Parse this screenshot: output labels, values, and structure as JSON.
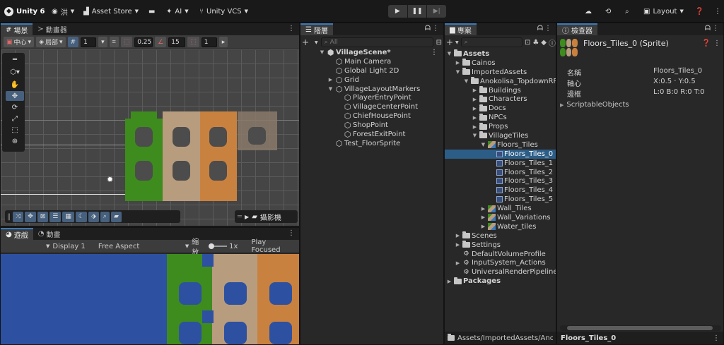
{
  "topbar": {
    "account": "Unity 6",
    "user": "洪",
    "asset_store": "Asset Store",
    "ai": "AI",
    "vcs": "Unity VCS",
    "layout": "Layout"
  },
  "scene": {
    "tabs": [
      "場景",
      "動畫器"
    ],
    "pivot": "中心",
    "space": "局部",
    "grid_size": "1",
    "snap_value": "0.25",
    "angle_value": "15",
    "scale_value": "1",
    "camera_label": "攝影機"
  },
  "game": {
    "tabs": [
      "遊戲",
      "動畫"
    ],
    "display": "Display 1",
    "aspect": "Free Aspect",
    "zoom_label": "縮放",
    "zoom_value": "1x",
    "play_mode": "Play Focused"
  },
  "hierarchy": {
    "tab": "階層",
    "search_placeholder": "All",
    "items": [
      {
        "label": "VillageScene*",
        "depth": 0,
        "arrow": "▼",
        "icon": "unity-icon",
        "bold": true
      },
      {
        "label": "Main Camera",
        "depth": 1,
        "arrow": "",
        "icon": "cube-icon"
      },
      {
        "label": "Global Light 2D",
        "depth": 1,
        "arrow": "",
        "icon": "cube-icon"
      },
      {
        "label": "Grid",
        "depth": 1,
        "arrow": "▶",
        "icon": "cube-icon"
      },
      {
        "label": "VillageLayoutMarkers",
        "depth": 1,
        "arrow": "▼",
        "icon": "cube-icon"
      },
      {
        "label": "PlayerEntryPoint",
        "depth": 2,
        "arrow": "",
        "icon": "cube-icon"
      },
      {
        "label": "VillageCenterPoint",
        "depth": 2,
        "arrow": "",
        "icon": "cube-icon"
      },
      {
        "label": "ChiefHousePoint",
        "depth": 2,
        "arrow": "",
        "icon": "cube-icon"
      },
      {
        "label": "ShopPoint",
        "depth": 2,
        "arrow": "",
        "icon": "cube-icon"
      },
      {
        "label": "ForestExitPoint",
        "depth": 2,
        "arrow": "",
        "icon": "cube-icon"
      },
      {
        "label": "Test_FloorSprite",
        "depth": 1,
        "arrow": "",
        "icon": "cube-icon"
      }
    ]
  },
  "project": {
    "tab": "專案",
    "path": "Assets/ImportedAssets/Anoko",
    "items": [
      {
        "label": "Assets",
        "depth": 0,
        "arrow": "▼",
        "icon": "folder-open",
        "bold": true
      },
      {
        "label": "Cainos",
        "depth": 1,
        "arrow": "▶",
        "icon": "folder"
      },
      {
        "label": "ImportedAssets",
        "depth": 1,
        "arrow": "▼",
        "icon": "folder-open"
      },
      {
        "label": "Anokolisa_TopdownRPG",
        "depth": 2,
        "arrow": "▼",
        "icon": "folder-open"
      },
      {
        "label": "Buildings",
        "depth": 3,
        "arrow": "▶",
        "icon": "folder"
      },
      {
        "label": "Characters",
        "depth": 3,
        "arrow": "▶",
        "icon": "folder"
      },
      {
        "label": "Docs",
        "depth": 3,
        "arrow": "▶",
        "icon": "folder"
      },
      {
        "label": "NPCs",
        "depth": 3,
        "arrow": "▶",
        "icon": "folder"
      },
      {
        "label": "Props",
        "depth": 3,
        "arrow": "▶",
        "icon": "folder"
      },
      {
        "label": "VillageTiles",
        "depth": 3,
        "arrow": "▼",
        "icon": "folder-open"
      },
      {
        "label": "Floors_Tiles",
        "depth": 4,
        "arrow": "▼",
        "icon": "sheet"
      },
      {
        "label": "Floors_Tiles_0",
        "depth": 5,
        "arrow": "",
        "icon": "sprite",
        "selected": true
      },
      {
        "label": "Floors_Tiles_1",
        "depth": 5,
        "arrow": "",
        "icon": "sprite"
      },
      {
        "label": "Floors_Tiles_2",
        "depth": 5,
        "arrow": "",
        "icon": "sprite"
      },
      {
        "label": "Floors_Tiles_3",
        "depth": 5,
        "arrow": "",
        "icon": "sprite"
      },
      {
        "label": "Floors_Tiles_4",
        "depth": 5,
        "arrow": "",
        "icon": "sprite"
      },
      {
        "label": "Floors_Tiles_5",
        "depth": 5,
        "arrow": "",
        "icon": "sprite"
      },
      {
        "label": "Wall_Tiles",
        "depth": 4,
        "arrow": "▶",
        "icon": "sheet"
      },
      {
        "label": "Wall_Variations",
        "depth": 4,
        "arrow": "▶",
        "icon": "sheet"
      },
      {
        "label": "Water_tiles",
        "depth": 4,
        "arrow": "▶",
        "icon": "sheet"
      },
      {
        "label": "Scenes",
        "depth": 1,
        "arrow": "▶",
        "icon": "folder"
      },
      {
        "label": "Settings",
        "depth": 1,
        "arrow": "▶",
        "icon": "folder"
      },
      {
        "label": "DefaultVolumeProfile",
        "depth": 1,
        "arrow": "",
        "icon": "asset"
      },
      {
        "label": "InputSystem_Actions",
        "depth": 1,
        "arrow": "▶",
        "icon": "asset"
      },
      {
        "label": "UniversalRenderPipelineGl",
        "depth": 1,
        "arrow": "",
        "icon": "asset"
      },
      {
        "label": "Packages",
        "depth": 0,
        "arrow": "▶",
        "icon": "folder",
        "bold": true
      }
    ]
  },
  "inspector": {
    "tab": "檢查器",
    "title": "Floors_Tiles_0 (Sprite)",
    "fields": [
      {
        "key": "名稱",
        "value": "Floors_Tiles_0"
      },
      {
        "key": "軸心",
        "value": "X:0.5 · Y:0.5"
      },
      {
        "key": "邊框",
        "value": "L:0 B:0 R:0 T:0"
      }
    ],
    "section": "ScriptableObjects",
    "footer": "Floors_Tiles_0"
  }
}
